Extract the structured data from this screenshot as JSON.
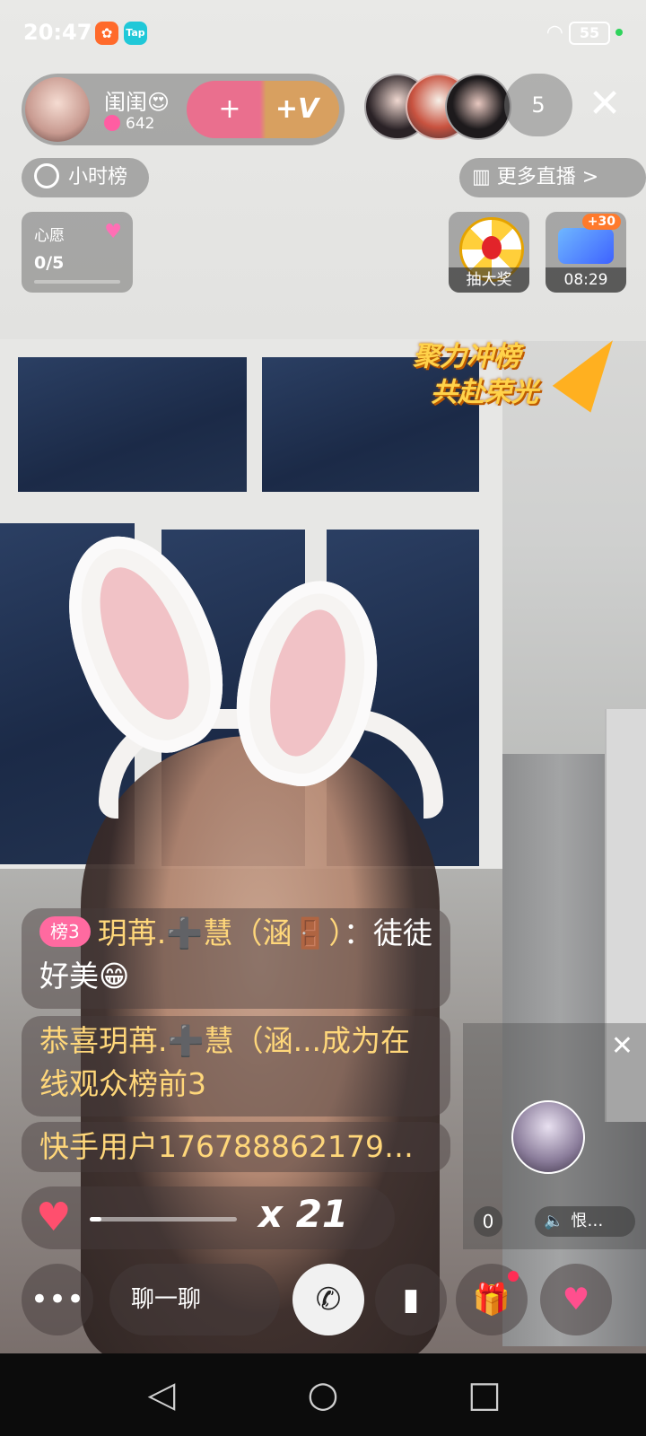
{
  "status_bar": {
    "time": "20:47",
    "battery": "55",
    "app_icons": [
      "kuaishou-icon",
      "tap-icon"
    ]
  },
  "host": {
    "name": "闺闺😍",
    "likes": "642",
    "follow_label": "+",
    "vip_label": "+V"
  },
  "viewers": {
    "count": "5"
  },
  "chips": {
    "hourly_rank": "小时榜",
    "more_live": "更多直播 >"
  },
  "wish": {
    "title": "心愿",
    "progress": "0/5"
  },
  "activities": {
    "lottery_label": "抽大奖",
    "timer": "08:29",
    "timer_badge": "+30"
  },
  "promo": {
    "line1": "聚力冲榜",
    "line2": "共赴荣光"
  },
  "chat": [
    {
      "badge": "榜3",
      "user": "玥苒.➕慧（涵🚪）",
      "text": "：徒徒好美😁"
    },
    {
      "text": "恭喜玥苒.➕慧（涵...成为在线观众榜前3"
    },
    {
      "text": "快手用户176788862179…"
    }
  ],
  "combo": {
    "multiplier": "x 21",
    "progress": 0.08
  },
  "mini_player": {
    "count": "0",
    "speaker_label": "恨…"
  },
  "bottom_bar": {
    "chat_placeholder": "聊一聊"
  },
  "colors": {
    "accent_pink": "#ff4f6e",
    "gold_text": "#ffd77a",
    "badge_pink": "#ff6aa0"
  }
}
